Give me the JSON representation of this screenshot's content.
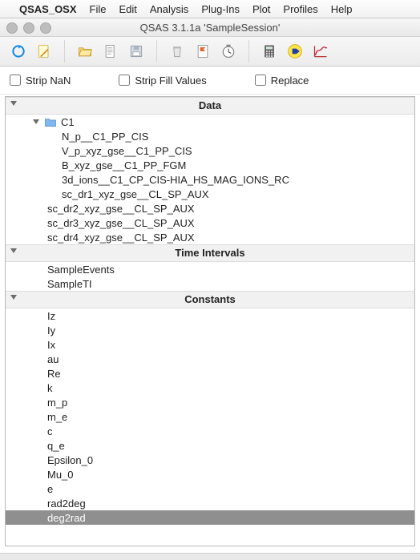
{
  "menubar": {
    "app": "QSAS_OSX",
    "items": [
      "File",
      "Edit",
      "Analysis",
      "Plug-Ins",
      "Plot",
      "Profiles",
      "Help"
    ]
  },
  "window": {
    "title": "QSAS 3.1.1a  'SampleSession'"
  },
  "toolbar_icons": {
    "refresh": "refresh-icon",
    "note": "note-icon",
    "open": "open-folder-icon",
    "doc": "document-icon",
    "save": "save-icon",
    "trash": "trash-icon",
    "flag": "flag-icon",
    "clock": "clock-icon",
    "calc": "calculator-icon",
    "run": "run-icon",
    "plot": "plot-icon"
  },
  "options": {
    "strip_nan": "Strip NaN",
    "strip_fill": "Strip Fill Values",
    "replace": "Replace"
  },
  "sections": {
    "data": "Data",
    "time": "Time Intervals",
    "constants": "Constants"
  },
  "tree": {
    "c1_label": "C1",
    "c1_children": [
      "N_p__C1_PP_CIS",
      "V_p_xyz_gse__C1_PP_CIS",
      "B_xyz_gse__C1_PP_FGM",
      "3d_ions__C1_CP_CIS-HIA_HS_MAG_IONS_RC",
      "sc_dr1_xyz_gse__CL_SP_AUX"
    ],
    "data_top": [
      "sc_dr2_xyz_gse__CL_SP_AUX",
      "sc_dr3_xyz_gse__CL_SP_AUX",
      "sc_dr4_xyz_gse__CL_SP_AUX"
    ],
    "time_items": [
      "SampleEvents",
      "SampleTI"
    ],
    "constants": [
      "Iz",
      "Iy",
      "Ix",
      "au",
      "Re",
      "k",
      "m_p",
      "m_e",
      "c",
      "q_e",
      "Epsilon_0",
      "Mu_0",
      "e",
      "rad2deg",
      "deg2rad"
    ],
    "selected": "deg2rad"
  }
}
